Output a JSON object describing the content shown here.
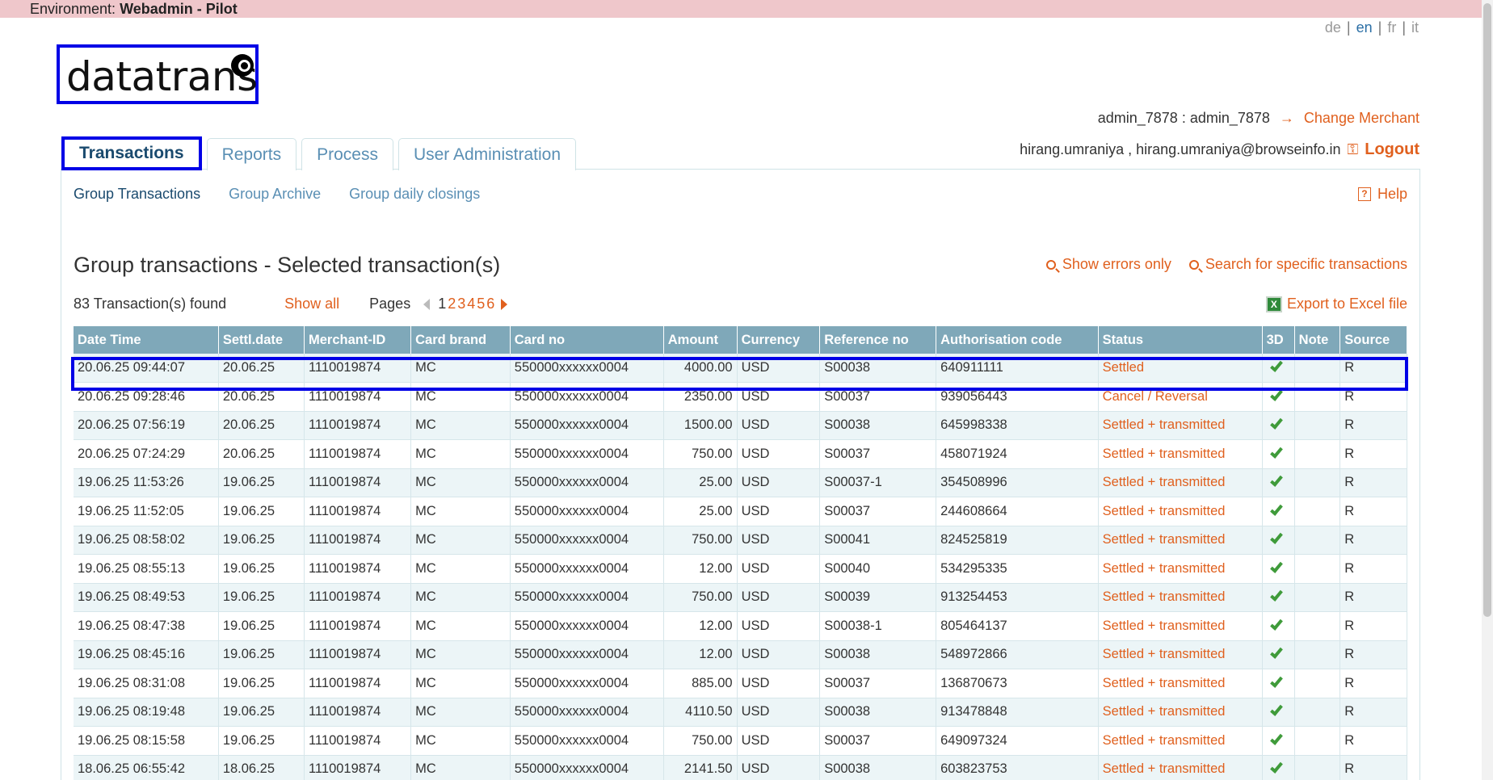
{
  "environment": {
    "prefix": "Environment:",
    "name": "Webadmin - Pilot"
  },
  "languages": [
    {
      "code": "de",
      "active": false
    },
    {
      "code": "en",
      "active": true
    },
    {
      "code": "fr",
      "active": false
    },
    {
      "code": "it",
      "active": false
    }
  ],
  "logo": {
    "text": "datatrans"
  },
  "merchant": {
    "account": "admin_7878 : admin_7878",
    "change_label": "Change Merchant"
  },
  "user": {
    "info": "hirang.umraniya , hirang.umraniya@browseinfo.in",
    "logout_label": "Logout"
  },
  "tabs": [
    {
      "label": "Transactions",
      "active": true
    },
    {
      "label": "Reports",
      "active": false
    },
    {
      "label": "Process",
      "active": false
    },
    {
      "label": "User Administration",
      "active": false
    }
  ],
  "subnav": [
    {
      "label": "Group Transactions",
      "active": true
    },
    {
      "label": "Group Archive",
      "active": false
    },
    {
      "label": "Group daily closings",
      "active": false
    }
  ],
  "help_label": "Help",
  "page_title": "Group transactions - Selected transaction(s)",
  "actions": {
    "show_errors": "Show errors only",
    "search_specific": "Search for specific transactions"
  },
  "results": {
    "found": "83 Transaction(s) found",
    "show_all": "Show all",
    "pages_label": "Pages",
    "pages": [
      "1",
      "2",
      "3",
      "4",
      "5",
      "6"
    ],
    "current_page": "1",
    "export_label": "Export to Excel file"
  },
  "table": {
    "columns": [
      "Date Time",
      "Settl.date",
      "Merchant-ID",
      "Card brand",
      "Card no",
      "Amount",
      "Currency",
      "Reference no",
      "Authorisation code",
      "Status",
      "3D",
      "Note",
      "Source"
    ],
    "rows": [
      [
        "20.06.25 09:44:07",
        "20.06.25",
        "1110019874",
        "MC",
        "550000xxxxxx0004",
        "4000.00",
        "USD",
        "S00038",
        "640911111",
        "Settled",
        "",
        "R"
      ],
      [
        "20.06.25 09:28:46",
        "20.06.25",
        "1110019874",
        "MC",
        "550000xxxxxx0004",
        "2350.00",
        "USD",
        "S00037",
        "939056443",
        "Cancel / Reversal",
        "",
        "R"
      ],
      [
        "20.06.25 07:56:19",
        "20.06.25",
        "1110019874",
        "MC",
        "550000xxxxxx0004",
        "1500.00",
        "USD",
        "S00038",
        "645998338",
        "Settled + transmitted",
        "",
        "R"
      ],
      [
        "20.06.25 07:24:29",
        "20.06.25",
        "1110019874",
        "MC",
        "550000xxxxxx0004",
        "750.00",
        "USD",
        "S00037",
        "458071924",
        "Settled + transmitted",
        "",
        "R"
      ],
      [
        "19.06.25 11:53:26",
        "19.06.25",
        "1110019874",
        "MC",
        "550000xxxxxx0004",
        "25.00",
        "USD",
        "S00037-1",
        "354508996",
        "Settled + transmitted",
        "",
        "R"
      ],
      [
        "19.06.25 11:52:05",
        "19.06.25",
        "1110019874",
        "MC",
        "550000xxxxxx0004",
        "25.00",
        "USD",
        "S00037",
        "244608664",
        "Settled + transmitted",
        "",
        "R"
      ],
      [
        "19.06.25 08:58:02",
        "19.06.25",
        "1110019874",
        "MC",
        "550000xxxxxx0004",
        "750.00",
        "USD",
        "S00041",
        "824525819",
        "Settled + transmitted",
        "",
        "R"
      ],
      [
        "19.06.25 08:55:13",
        "19.06.25",
        "1110019874",
        "MC",
        "550000xxxxxx0004",
        "12.00",
        "USD",
        "S00040",
        "534295335",
        "Settled + transmitted",
        "",
        "R"
      ],
      [
        "19.06.25 08:49:53",
        "19.06.25",
        "1110019874",
        "MC",
        "550000xxxxxx0004",
        "750.00",
        "USD",
        "S00039",
        "913254453",
        "Settled + transmitted",
        "",
        "R"
      ],
      [
        "19.06.25 08:47:38",
        "19.06.25",
        "1110019874",
        "MC",
        "550000xxxxxx0004",
        "12.00",
        "USD",
        "S00038-1",
        "805464137",
        "Settled + transmitted",
        "",
        "R"
      ],
      [
        "19.06.25 08:45:16",
        "19.06.25",
        "1110019874",
        "MC",
        "550000xxxxxx0004",
        "12.00",
        "USD",
        "S00038",
        "548972866",
        "Settled + transmitted",
        "",
        "R"
      ],
      [
        "19.06.25 08:31:08",
        "19.06.25",
        "1110019874",
        "MC",
        "550000xxxxxx0004",
        "885.00",
        "USD",
        "S00037",
        "136870673",
        "Settled + transmitted",
        "",
        "R"
      ],
      [
        "19.06.25 08:19:48",
        "19.06.25",
        "1110019874",
        "MC",
        "550000xxxxxx0004",
        "4110.50",
        "USD",
        "S00038",
        "913478848",
        "Settled + transmitted",
        "",
        "R"
      ],
      [
        "19.06.25 08:15:58",
        "19.06.25",
        "1110019874",
        "MC",
        "550000xxxxxx0004",
        "750.00",
        "USD",
        "S00037",
        "649097324",
        "Settled + transmitted",
        "",
        "R"
      ],
      [
        "18.06.25 06:55:42",
        "18.06.25",
        "1110019874",
        "MC",
        "550000xxxxxx0004",
        "2141.50",
        "USD",
        "S00038",
        "603823753",
        "Settled + transmitted",
        "",
        "R"
      ]
    ]
  },
  "colors": {
    "accent": "#e0601e",
    "link": "#5a8fb4",
    "header_bg": "#7fa8b9",
    "selection": "#0000e6",
    "env_bar": "#efc7cb"
  }
}
